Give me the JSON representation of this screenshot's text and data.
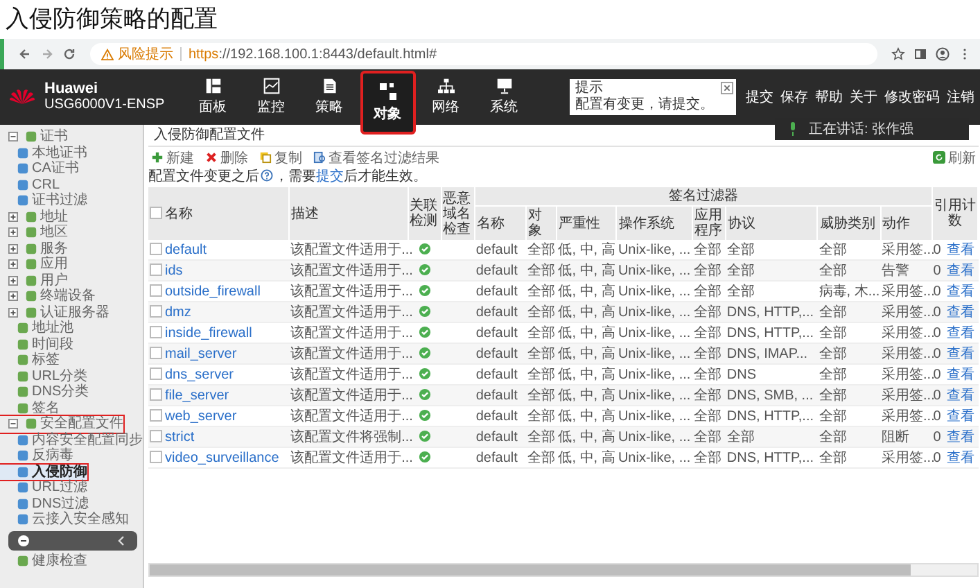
{
  "page_title": "入侵防御策略的配置",
  "browser": {
    "warning": "风险提示",
    "url_scheme": "https",
    "url_rest": "://192.168.100.1:8443/default.html#"
  },
  "header": {
    "brand": "Huawei",
    "model": "USG6000V1-ENSP",
    "nav": [
      {
        "label": "面板",
        "selected": false,
        "annotated": false
      },
      {
        "label": "监控",
        "selected": false,
        "annotated": false
      },
      {
        "label": "策略",
        "selected": false,
        "annotated": false
      },
      {
        "label": "对象",
        "selected": true,
        "annotated": true
      },
      {
        "label": "网络",
        "selected": false,
        "annotated": false
      },
      {
        "label": "系统",
        "selected": false,
        "annotated": false
      }
    ],
    "tip": {
      "title": "提示",
      "message": "配置有变更，请提交。"
    },
    "links": [
      "提交",
      "保存",
      "帮助",
      "关于",
      "修改密码",
      "注销"
    ],
    "speaking": "正在讲话: 张作强"
  },
  "sidebar": {
    "items": [
      {
        "label": "证书",
        "kind": "group",
        "expanded": true,
        "selected": false,
        "annotated": false,
        "children": [
          {
            "label": "本地证书",
            "selected": false,
            "annotated": false
          },
          {
            "label": "CA证书",
            "selected": false,
            "annotated": false
          },
          {
            "label": "CRL",
            "selected": false,
            "annotated": false
          },
          {
            "label": "证书过滤",
            "selected": false,
            "annotated": false
          }
        ]
      },
      {
        "label": "地址",
        "kind": "group",
        "expanded": false,
        "selected": false,
        "annotated": false
      },
      {
        "label": "地区",
        "kind": "group",
        "expanded": false,
        "selected": false,
        "annotated": false
      },
      {
        "label": "服务",
        "kind": "group",
        "expanded": false,
        "selected": false,
        "annotated": false
      },
      {
        "label": "应用",
        "kind": "group",
        "expanded": false,
        "selected": false,
        "annotated": false
      },
      {
        "label": "用户",
        "kind": "group",
        "expanded": false,
        "selected": false,
        "annotated": false
      },
      {
        "label": "终端设备",
        "kind": "group",
        "expanded": false,
        "selected": false,
        "annotated": false
      },
      {
        "label": "认证服务器",
        "kind": "group",
        "expanded": false,
        "selected": false,
        "annotated": false
      },
      {
        "label": "地址池",
        "kind": "leaf",
        "selected": false,
        "annotated": false
      },
      {
        "label": "时间段",
        "kind": "leaf",
        "selected": false,
        "annotated": false
      },
      {
        "label": "标签",
        "kind": "leaf",
        "selected": false,
        "annotated": false
      },
      {
        "label": "URL分类",
        "kind": "leaf",
        "selected": false,
        "annotated": false
      },
      {
        "label": "DNS分类",
        "kind": "leaf",
        "selected": false,
        "annotated": false
      },
      {
        "label": "签名",
        "kind": "leaf",
        "selected": false,
        "annotated": false
      },
      {
        "label": "安全配置文件",
        "kind": "group",
        "expanded": true,
        "selected": false,
        "annotated": true,
        "children": [
          {
            "label": "内容安全配置同步",
            "selected": false,
            "annotated": false
          },
          {
            "label": "反病毒",
            "selected": false,
            "annotated": false
          },
          {
            "label": "入侵防御",
            "selected": true,
            "annotated": true
          },
          {
            "label": "URL过滤",
            "selected": false,
            "annotated": false
          },
          {
            "label": "DNS过滤",
            "selected": false,
            "annotated": false
          },
          {
            "label": "云接入安全感知",
            "selected": false,
            "annotated": false
          }
        ]
      },
      {
        "label": "健康检查",
        "kind": "leaf",
        "selected": false,
        "annotated": false
      }
    ]
  },
  "panel": {
    "title": "入侵防御配置文件",
    "toolbar": [
      "新建",
      "删除",
      "复制",
      "查看签名过滤结果"
    ],
    "refresh": "刷新",
    "note": {
      "before": "配置文件变更之后",
      "middle": "，需要",
      "link": "提交",
      "after": "后才能生效。"
    },
    "table": {
      "columns": [
        "名称",
        "描述",
        "关联检测",
        "恶意域名检查"
      ],
      "group": {
        "label": "签名过滤器",
        "columns": [
          "名称",
          "对象",
          "严重性",
          "操作系统",
          "应用程序",
          "协议",
          "威胁类别",
          "动作"
        ]
      },
      "tail_column": "引用计数",
      "select_all_checked": false,
      "rows": [
        {
          "checked": false,
          "name": "default",
          "description": "该配置文件适用于...",
          "linked_check": true,
          "filter": [
            "default",
            "全部",
            "低, 中, 高",
            "Unix-like, ...",
            "全部",
            "全部",
            "全部",
            "采用签..."
          ],
          "ref_count": "0",
          "ref_link": "查看"
        },
        {
          "checked": false,
          "name": "ids",
          "description": "该配置文件适用于...",
          "linked_check": true,
          "filter": [
            "default",
            "全部",
            "低, 中, 高",
            "Unix-like, ...",
            "全部",
            "全部",
            "全部",
            "告警"
          ],
          "ref_count": "0",
          "ref_link": "查看"
        },
        {
          "checked": false,
          "name": "outside_firewall",
          "description": "该配置文件适用于...",
          "linked_check": true,
          "filter": [
            "default",
            "全部",
            "低, 中, 高",
            "Unix-like, ...",
            "全部",
            "全部",
            "病毒, 木...",
            "采用签..."
          ],
          "ref_count": "0",
          "ref_link": "查看"
        },
        {
          "checked": false,
          "name": "dmz",
          "description": "该配置文件适用于...",
          "linked_check": true,
          "filter": [
            "default",
            "全部",
            "低, 中, 高",
            "Unix-like, ...",
            "全部",
            "DNS, HTTP,...",
            "全部",
            "采用签..."
          ],
          "ref_count": "0",
          "ref_link": "查看"
        },
        {
          "checked": false,
          "name": "inside_firewall",
          "description": "该配置文件适用于...",
          "linked_check": true,
          "filter": [
            "default",
            "全部",
            "低, 中, 高",
            "Unix-like, ...",
            "全部",
            "DNS, HTTP,...",
            "全部",
            "采用签..."
          ],
          "ref_count": "0",
          "ref_link": "查看"
        },
        {
          "checked": false,
          "name": "mail_server",
          "description": "该配置文件适用于...",
          "linked_check": true,
          "filter": [
            "default",
            "全部",
            "低, 中, 高",
            "Unix-like, ...",
            "全部",
            "DNS, IMAP...",
            "全部",
            "采用签..."
          ],
          "ref_count": "0",
          "ref_link": "查看"
        },
        {
          "checked": false,
          "name": "dns_server",
          "description": "该配置文件适用于...",
          "linked_check": true,
          "filter": [
            "default",
            "全部",
            "低, 中, 高",
            "Unix-like, ...",
            "全部",
            "DNS",
            "全部",
            "采用签..."
          ],
          "ref_count": "0",
          "ref_link": "查看"
        },
        {
          "checked": false,
          "name": "file_server",
          "description": "该配置文件适用于...",
          "linked_check": true,
          "filter": [
            "default",
            "全部",
            "低, 中, 高",
            "Unix-like, ...",
            "全部",
            "DNS, SMB, ...",
            "全部",
            "采用签..."
          ],
          "ref_count": "0",
          "ref_link": "查看"
        },
        {
          "checked": false,
          "name": "web_server",
          "description": "该配置文件适用于...",
          "linked_check": true,
          "filter": [
            "default",
            "全部",
            "低, 中, 高",
            "Unix-like, ...",
            "全部",
            "DNS, HTTP,...",
            "全部",
            "采用签..."
          ],
          "ref_count": "0",
          "ref_link": "查看"
        },
        {
          "checked": false,
          "name": "strict",
          "description": "该配置文件将强制...",
          "linked_check": true,
          "filter": [
            "default",
            "全部",
            "低, 中, 高",
            "Unix-like, ...",
            "全部",
            "全部",
            "全部",
            "阻断"
          ],
          "ref_count": "0",
          "ref_link": "查看"
        },
        {
          "checked": false,
          "name": "video_surveillance",
          "description": "该配置文件适用于...",
          "linked_check": true,
          "filter": [
            "default",
            "全部",
            "低, 中, 高",
            "Unix-like, ...",
            "全部",
            "DNS, HTTP,...",
            "全部",
            "采用签..."
          ],
          "ref_count": "0",
          "ref_link": "查看"
        }
      ]
    }
  }
}
